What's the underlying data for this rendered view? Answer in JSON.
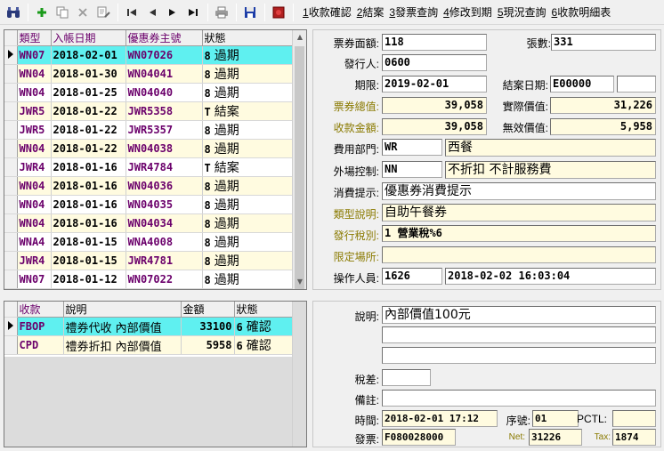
{
  "toolbar": {
    "links": [
      {
        "key": "1",
        "label": "收款確認"
      },
      {
        "key": "2",
        "label": "結案"
      },
      {
        "key": "3",
        "label": "發票查詢"
      },
      {
        "key": "4",
        "label": "修改到期"
      },
      {
        "key": "5",
        "label": "現況查詢"
      },
      {
        "key": "6",
        "label": "收款明細表"
      }
    ]
  },
  "voucher_grid": {
    "columns": [
      "類型",
      "入帳日期",
      "優惠券主號",
      "狀態"
    ],
    "rows": [
      {
        "type": "WN07",
        "date": "2018-02-01",
        "no": "WN07026",
        "code": "8",
        "status": "過期",
        "selected": true
      },
      {
        "type": "WN04",
        "date": "2018-01-30",
        "no": "WN04041",
        "code": "8",
        "status": "過期"
      },
      {
        "type": "WN04",
        "date": "2018-01-25",
        "no": "WN04040",
        "code": "8",
        "status": "過期"
      },
      {
        "type": "JWR5",
        "date": "2018-01-22",
        "no": "JWR5358",
        "code": "T",
        "status": "結案"
      },
      {
        "type": "JWR5",
        "date": "2018-01-22",
        "no": "JWR5357",
        "code": "8",
        "status": "過期"
      },
      {
        "type": "WN04",
        "date": "2018-01-22",
        "no": "WN04038",
        "code": "8",
        "status": "過期"
      },
      {
        "type": "JWR4",
        "date": "2018-01-16",
        "no": "JWR4784",
        "code": "T",
        "status": "結案"
      },
      {
        "type": "WN04",
        "date": "2018-01-16",
        "no": "WN04036",
        "code": "8",
        "status": "過期"
      },
      {
        "type": "WN04",
        "date": "2018-01-16",
        "no": "WN04035",
        "code": "8",
        "status": "過期"
      },
      {
        "type": "WN04",
        "date": "2018-01-16",
        "no": "WN04034",
        "code": "8",
        "status": "過期"
      },
      {
        "type": "WNA4",
        "date": "2018-01-15",
        "no": "WNA4008",
        "code": "8",
        "status": "過期"
      },
      {
        "type": "JWR4",
        "date": "2018-01-15",
        "no": "JWR4781",
        "code": "8",
        "status": "過期"
      },
      {
        "type": "WN07",
        "date": "2018-01-12",
        "no": "WN07022",
        "code": "8",
        "status": "過期"
      }
    ]
  },
  "payment_grid": {
    "columns": [
      "收款",
      "說明",
      "金額",
      "狀態"
    ],
    "rows": [
      {
        "code": "FBOP",
        "desc": "禮券代收 內部價值",
        "amount": "33100",
        "scode": "6",
        "status": "確認",
        "selected": true
      },
      {
        "code": "CPD",
        "desc": "禮券折扣 內部價值",
        "amount": "5958",
        "scode": "6",
        "status": "確認"
      }
    ]
  },
  "detail": {
    "face_value_label": "票券面額:",
    "face_value": "118",
    "count_label": "張數:",
    "count": "331",
    "issuer_label": "發行人:",
    "issuer": "0600",
    "due_label": "期限:",
    "due": "2019-02-01",
    "close_date_label": "結案日期:",
    "close_date": "E00000",
    "close_extra": "",
    "total_label": "票券總值:",
    "total": "39,058",
    "actual_label": "實際價值:",
    "actual": "31,226",
    "received_label": "收款金額:",
    "received": "39,058",
    "invalid_label": "無效價值:",
    "invalid": "5,958",
    "dept_label": "費用部門:",
    "dept_code": "WR",
    "dept_name": "西餐",
    "ctrl_label": "外場控制:",
    "ctrl_code": "NN",
    "ctrl_name": "不折扣 不計服務費",
    "hint_label": "消費提示:",
    "hint": "優惠券消費提示",
    "typedesc_label": "類型說明:",
    "typedesc": "自助午餐券",
    "tax_label": "發行稅別:",
    "tax": "1 營業稅%6",
    "venue_label": "限定場所:",
    "venue": "",
    "operator_label": "操作人員:",
    "operator": "1626",
    "op_time": "2018-02-02 16:03:04"
  },
  "payment_detail": {
    "desc_label": "說明:",
    "desc1": "內部價值100元",
    "desc2": "",
    "desc3": "",
    "taxdiff_label": "稅差:",
    "taxdiff": "",
    "remark_label": "備註:",
    "remark": "",
    "time_label": "時間:",
    "time": "2018-02-01 17:12",
    "seq_label": "序號:",
    "seq": "01",
    "pctl_label": "PCTL:",
    "pctl": "",
    "invoice_label": "發票:",
    "invoice": "F080028000",
    "net_label": "Net:",
    "net": "31226",
    "taxamt_label": "Tax:",
    "taxamt": "1874"
  }
}
